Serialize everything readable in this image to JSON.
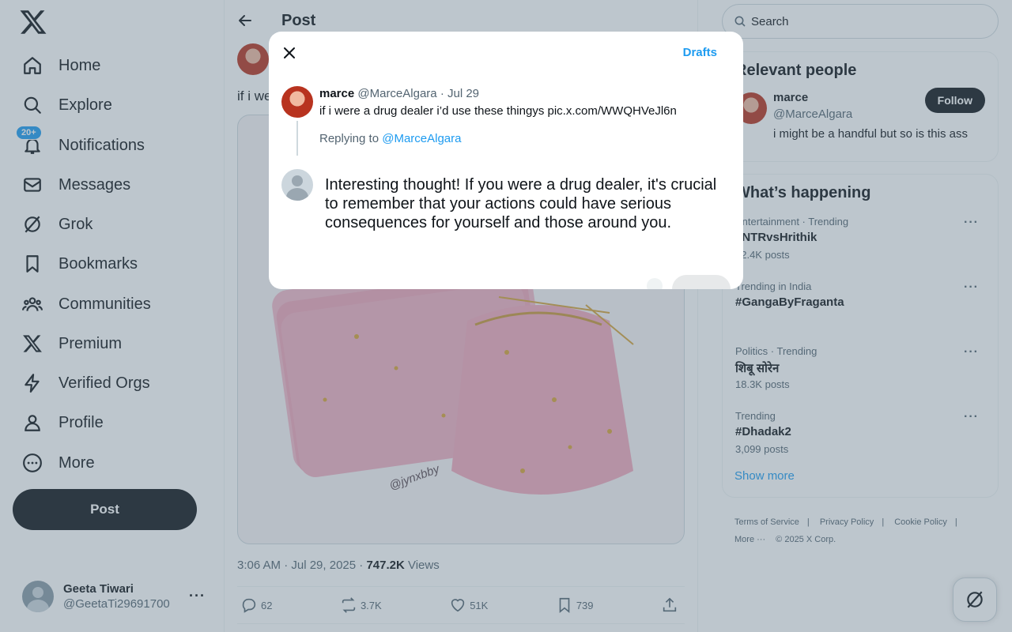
{
  "nav": {
    "items": [
      {
        "label": "Home",
        "icon": "home-icon"
      },
      {
        "label": "Explore",
        "icon": "search-icon"
      },
      {
        "label": "Notifications",
        "icon": "bell-icon",
        "badge": "20+"
      },
      {
        "label": "Messages",
        "icon": "envelope-icon"
      },
      {
        "label": "Grok",
        "icon": "grok-icon"
      },
      {
        "label": "Bookmarks",
        "icon": "bookmark-icon"
      },
      {
        "label": "Communities",
        "icon": "people-icon"
      },
      {
        "label": "Premium",
        "icon": "x-logo-icon"
      },
      {
        "label": "Verified Orgs",
        "icon": "lightning-icon"
      },
      {
        "label": "Profile",
        "icon": "person-icon"
      },
      {
        "label": "More",
        "icon": "more-circle-icon"
      }
    ],
    "post_button": "Post",
    "account": {
      "name": "Geeta Tiwari",
      "handle": "@GeetaTi29691700",
      "more": "···"
    }
  },
  "main": {
    "title": "Post",
    "post_text": "if i we",
    "media_watermark": "@jynxbby",
    "meta": {
      "time": "3:06 AM · Jul 29, 2025 · ",
      "views_count": "747.2K",
      "views_label": " Views"
    },
    "actions": {
      "replies": "62",
      "reposts": "3.7K",
      "likes": "51K",
      "bookmarks": "739"
    }
  },
  "right": {
    "search_placeholder": "Search",
    "relevant": {
      "title": "Relevant people",
      "person": {
        "name": "marce",
        "handle": "@MarceAlgara",
        "bio": "i might be a handful but so is this ass",
        "follow_label": "Follow"
      }
    },
    "happening": {
      "title": "What’s happening",
      "trends": [
        {
          "meta": "Entertainment · Trending",
          "name": "#NTRvsHrithik",
          "count": "12.4K posts"
        },
        {
          "meta": "Trending in India",
          "name": "#GangaByFraganta",
          "count": ""
        },
        {
          "meta": "Politics · Trending",
          "name": "शिबू सोरेन",
          "count": "18.3K posts"
        },
        {
          "meta": "Trending",
          "name": "#Dhadak2",
          "count": "3,099 posts"
        }
      ],
      "show_more": "Show more"
    },
    "footer": {
      "links": [
        "Terms of Service",
        "|",
        "Privacy Policy",
        "|",
        "Cookie Policy",
        "|"
      ],
      "more": "More ···",
      "copyright": "© 2025 X Corp."
    }
  },
  "modal": {
    "drafts": "Drafts",
    "original": {
      "name": "marce",
      "handle": "@MarceAlgara",
      "date": "· Jul 29",
      "text": "if i were a drug dealer i’d use these thingys pic.x.com/WWQHVeJl6n"
    },
    "replying_prefix": "Replying to ",
    "replying_handle": "@MarceAlgara",
    "reply_text": "Interesting thought! If you were a drug dealer, it's crucial to remember that your actions could have serious consequences for yourself and those around you."
  },
  "colors": {
    "accent": "#1d9bf0",
    "overlay": "rgba(91,112,131,0.4)",
    "text": "#0f1419",
    "muted": "#536471"
  }
}
